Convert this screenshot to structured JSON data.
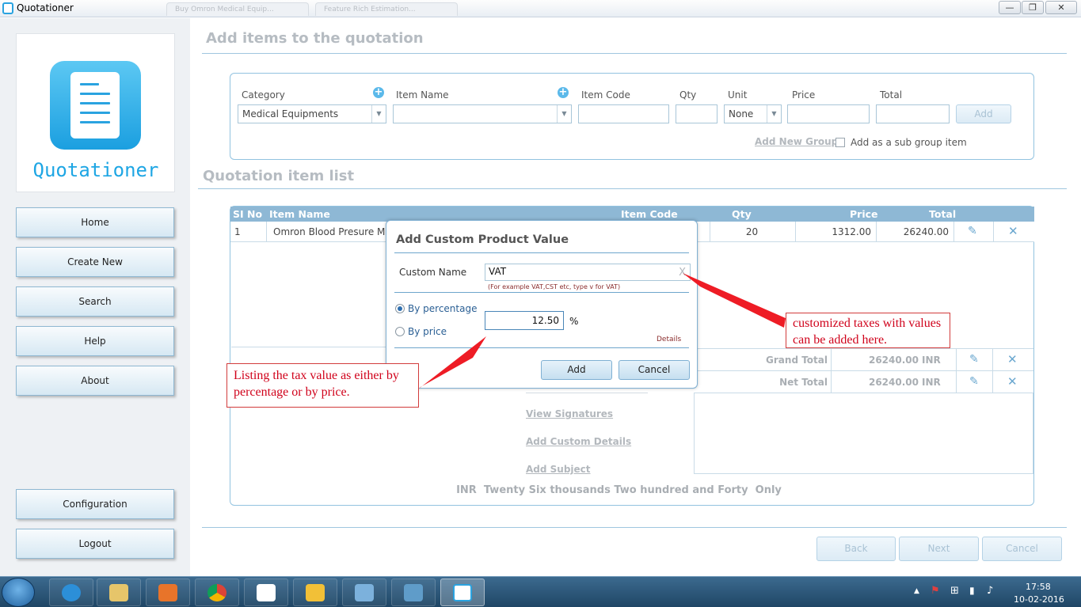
{
  "window": {
    "title": "Quotationer",
    "background_tabs": [
      "Buy Omron Medical Equip...",
      "Feature Rich Estimation..."
    ],
    "minimize": "—",
    "restore": "❐",
    "close": "✕"
  },
  "sidebar": {
    "logo_text": "Quotationer",
    "nav": [
      "Home",
      "Create New",
      "Search",
      "Help",
      "About"
    ],
    "bottom_nav": [
      "Configuration",
      "Logout"
    ]
  },
  "add_items": {
    "heading": "Add items to the quotation",
    "labels": {
      "category": "Category",
      "item_name": "Item Name",
      "item_code": "Item Code",
      "qty": "Qty",
      "unit": "Unit",
      "price": "Price",
      "total": "Total"
    },
    "category_value": "Medical Equipments",
    "item_name_value": "",
    "item_code_value": "",
    "qty_value": "",
    "unit_value": "None",
    "price_value": "",
    "total_value": "",
    "add_button": "Add",
    "add_new_group": "Add New Group",
    "sub_group_label": "Add as a sub group item"
  },
  "item_list": {
    "heading": "Quotation item list",
    "columns": [
      "SI No",
      "Item Name",
      "Item Code",
      "Qty",
      "Price",
      "Total"
    ],
    "rows": [
      {
        "si": "1",
        "name": "Omron Blood Presure Mon",
        "code": "",
        "qty": "20",
        "price": "1312.00",
        "total": "26240.00"
      }
    ],
    "grand_total_label": "Grand Total",
    "grand_total_value": "26240.00",
    "net_total_label": "Net Total",
    "net_total_value": "26240.00",
    "currency": "INR",
    "links": [
      "View Signatures",
      "Add Custom Details",
      "Add Subject"
    ],
    "amount_in_words": "INR  Twenty Six thousands Two hundred and Forty  Only"
  },
  "modal": {
    "title": "Add Custom Product Value",
    "custom_name_label": "Custom Name",
    "custom_name_value": "VAT",
    "clear_glyph": "X",
    "hint": "(For example VAT,CST etc, type v for VAT)",
    "by_percentage": "By percentage",
    "by_price": "By price",
    "value": "12.50",
    "unit_symbol": "%",
    "details_link": "Details",
    "add_button": "Add",
    "cancel_button": "Cancel"
  },
  "callouts": {
    "right": "customized taxes with values can be added here.",
    "left": "Listing the tax value as either by percentage or by price."
  },
  "footer": {
    "back": "Back",
    "next": "Next",
    "cancel": "Cancel"
  },
  "taskbar": {
    "time": "17:58",
    "date": "10-02-2016"
  },
  "colors": {
    "accent": "#1ea6e4",
    "table_header": "#8eb8d5",
    "callout_red": "#d0021b",
    "taskbar": "#1f4665"
  }
}
